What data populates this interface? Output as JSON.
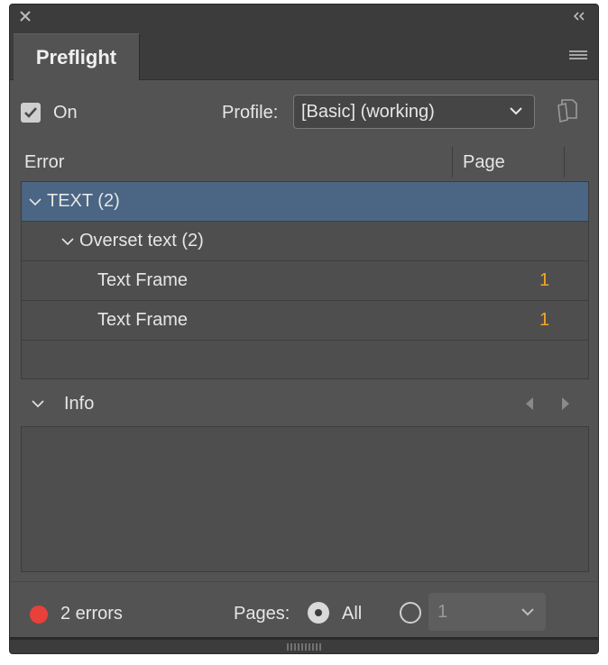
{
  "panel": {
    "tab_label": "Preflight"
  },
  "controls": {
    "on_label": "On",
    "on_checked": true,
    "profile_label": "Profile:",
    "profile_value": "[Basic] (working)"
  },
  "columns": {
    "error": "Error",
    "page": "Page"
  },
  "tree": {
    "category": "TEXT (2)",
    "subcategory": "Overset text (2)",
    "items": [
      {
        "label": "Text Frame",
        "page": "1"
      },
      {
        "label": "Text Frame",
        "page": "1"
      }
    ]
  },
  "info": {
    "label": "Info"
  },
  "footer": {
    "errors_label": "2 errors",
    "pages_label": "Pages:",
    "all_label": "All",
    "page_range_value": "1"
  },
  "colors": {
    "panel_bg": "#535353",
    "selection": "#4b6584",
    "page_number": "#f5a623",
    "error_dot": "#e8403a"
  }
}
